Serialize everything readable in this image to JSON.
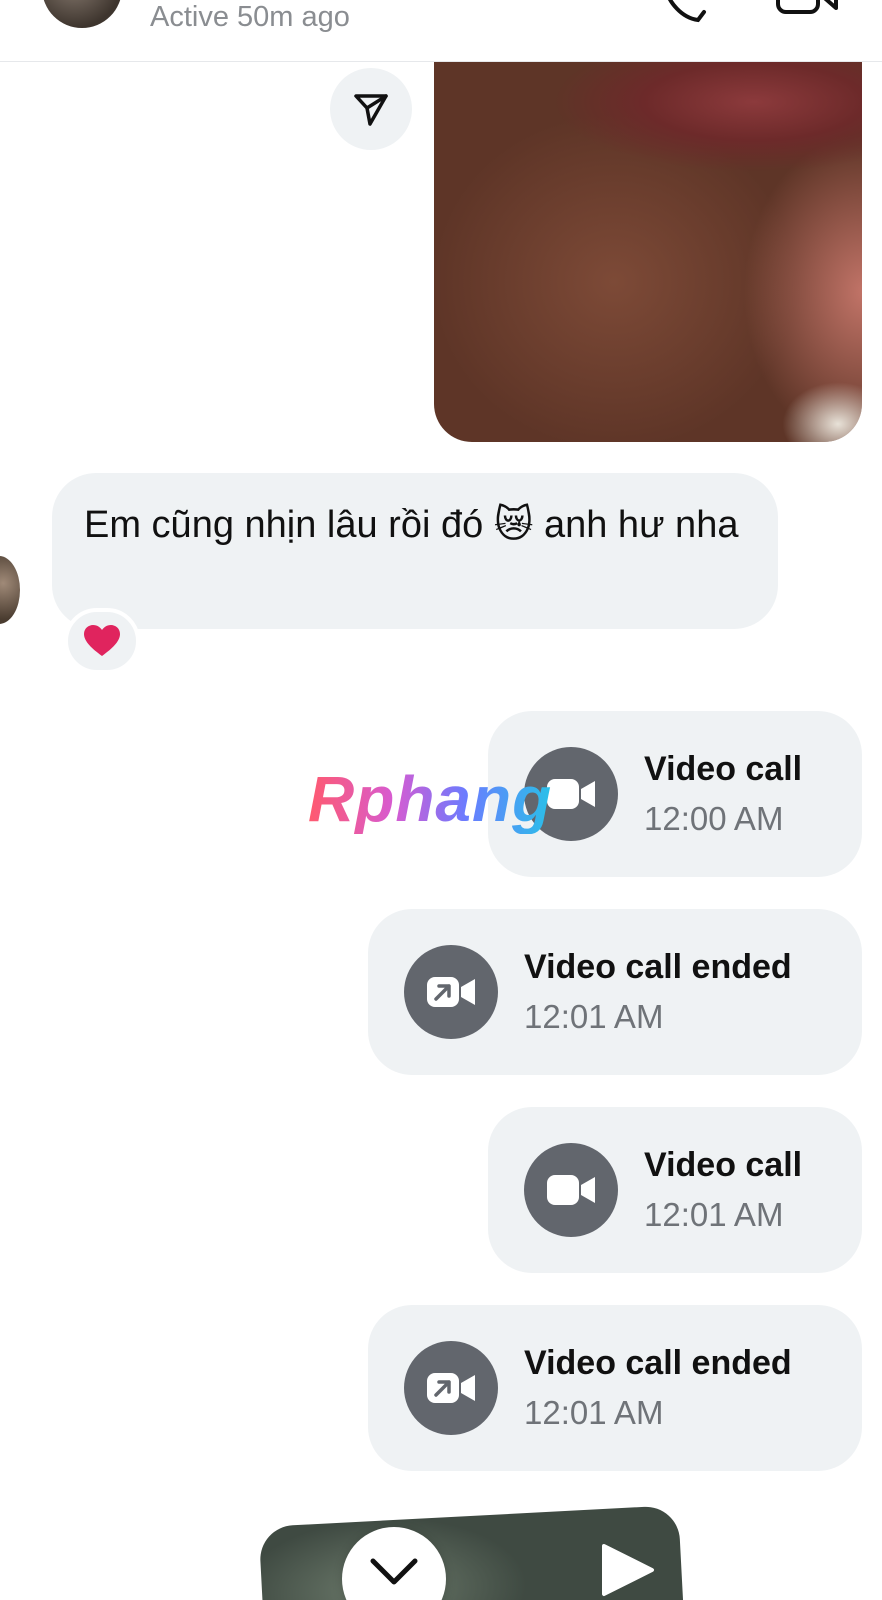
{
  "header": {
    "status": "Active 50m ago"
  },
  "messages": {
    "received_text": "Em cũng nhịn lâu rồi đó 😿 anh hư nha",
    "reaction": "❤️"
  },
  "calls": [
    {
      "title": "Video call",
      "time": "12:00 AM",
      "icon": "video-camera-icon"
    },
    {
      "title": "Video call ended",
      "time": "12:01 AM",
      "icon": "video-call-ended-icon"
    },
    {
      "title": "Video call",
      "time": "12:01 AM",
      "icon": "video-camera-icon"
    },
    {
      "title": "Video call ended",
      "time": "12:01 AM",
      "icon": "video-call-ended-icon"
    }
  ],
  "watermark": "Rphang",
  "colors": {
    "bubble": "#eff2f4",
    "icon_circle": "#62666d",
    "muted_text": "#6f7378"
  }
}
